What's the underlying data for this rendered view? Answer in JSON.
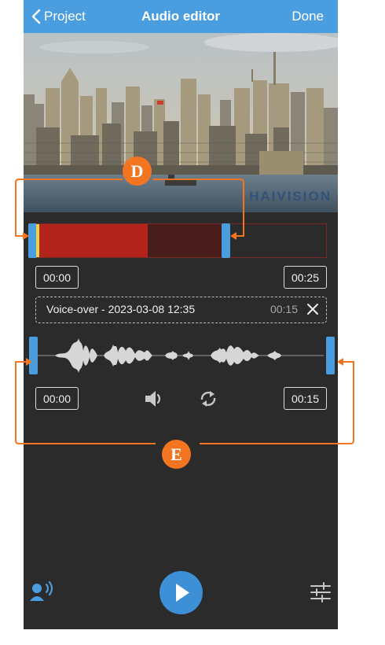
{
  "navbar": {
    "back_label": "Project",
    "title": "Audio editor",
    "done_label": "Done"
  },
  "video": {
    "watermark": "HAIVISION"
  },
  "video_track": {
    "start_time": "00:00",
    "end_time": "00:25"
  },
  "clip": {
    "name": "Voice-over - 2023-03-08 12:35",
    "duration": "00:15"
  },
  "audio_track": {
    "start_time": "00:00",
    "end_time": "00:15"
  },
  "callouts": {
    "d": "D",
    "e": "E"
  },
  "colors": {
    "accent": "#4a9ee0",
    "callout": "#f47521",
    "track_red": "#b3241c",
    "background": "#2b2b2b"
  },
  "icons": {
    "back": "chevron-left-icon",
    "volume": "volume-icon",
    "loop": "loop-icon",
    "close": "close-icon",
    "play": "play-icon",
    "voiceover": "voiceover-icon",
    "settings": "sliders-icon"
  }
}
